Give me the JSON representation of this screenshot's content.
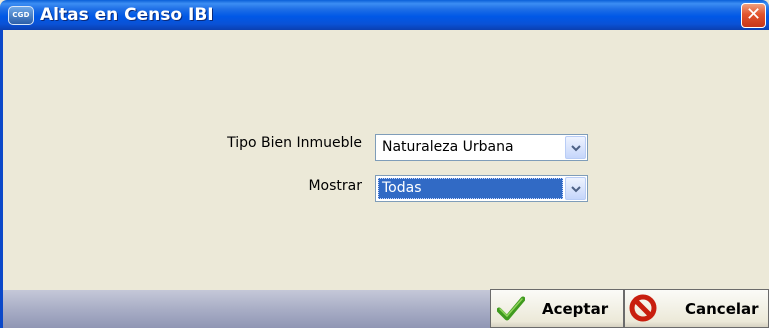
{
  "window": {
    "title": "Altas en Censo IBI",
    "icon_text": "CGD",
    "close_label": "✕"
  },
  "form": {
    "tipo_label": "Tipo Bien Inmueble",
    "tipo_value": "Naturaleza Urbana",
    "mostrar_label": "Mostrar",
    "mostrar_value": "Todas"
  },
  "buttons": {
    "accept_label": "Aceptar",
    "cancel_label": "Cancelar"
  },
  "colors": {
    "titlebar": "#0058e6",
    "close": "#e2542d",
    "selection": "#316ac5",
    "panel": "#ece9d8"
  },
  "icons": [
    "app-icon",
    "close-icon",
    "chevron-down-icon",
    "checkmark-icon",
    "cancel-icon"
  ]
}
